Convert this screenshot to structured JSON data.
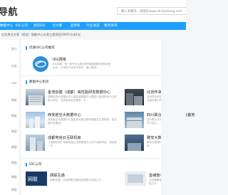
{
  "header": {
    "logo_text": "导航",
    "search_placeholder": "输入关键词，如域名www.idcdaohang.com"
  },
  "nav": {
    "items": [
      "数据中心机房",
      "IDC公司",
      "酒店IDC",
      "云计算",
      "运营商",
      "行业动态",
      "服务资讯"
    ]
  },
  "notice": "亿北京方方家（西北）智能中心方家工程项目100平方米1亿",
  "sidebar": {
    "items": [
      {
        "label": "统计"
      },
      {
        "label": "自由"
      },
      {
        "label": "VAR"
      },
      {
        "label": "数据"
      },
      {
        "label": "数据"
      },
      {
        "label": "数据"
      },
      {
        "label": "数据"
      },
      {
        "label": "数据"
      },
      {
        "label": "数据"
      },
      {
        "label": "数据"
      }
    ]
  },
  "section_featured": {
    "title": "优质IDC公司推荐",
    "company": {
      "name": "IDL网络",
      "desc": "IDL网络，是一家专业从事互联网数据服务的科技型企业，公司位于北京中关村，核心提供..."
    }
  },
  "section_datacenters": {
    "title": "数据中心机房",
    "items": [
      {
        "name": "金茂创建（成都）高性能研发数据中心",
        "desc": "成都金茂天府国际中心高性能数据中心是四川金茂科技中心的核心项目，支持多种业务需求，方..."
      },
      {
        "name": "北京怀来科学数据中心",
        "desc": "北京怀来科学数据中心位于河北省张家口市怀来县，为..."
      },
      {
        "name": "西安航空大数据中心",
        "desc": "西安航空大数据中心是由西安航空基地管委会主导规划，航空城开发集团..."
      },
      {
        "name": "四川联合天府云数据产业基地",
        "desc": "四川联合天府云数据产业基地位于四川..."
      },
      {
        "name": "成都电信云互联机房",
        "desc": "【成都机房】成都电信云互联数据中心位于成都市区，电信新一代..."
      },
      {
        "name": "雅安大数据产业园",
        "desc": "雅安大数据产业园位于四川雅安..."
      }
    ]
  },
  "section_idc": {
    "title": "IDC公司",
    "items": [
      {
        "name": "网联互通",
        "desc": "网联互通，北京网联互通科技有限公司成立于..."
      },
      {
        "name": "壹峰智仓",
        "desc": "北京壹峰智仓科技有限公司，致力于..."
      }
    ]
  }
}
